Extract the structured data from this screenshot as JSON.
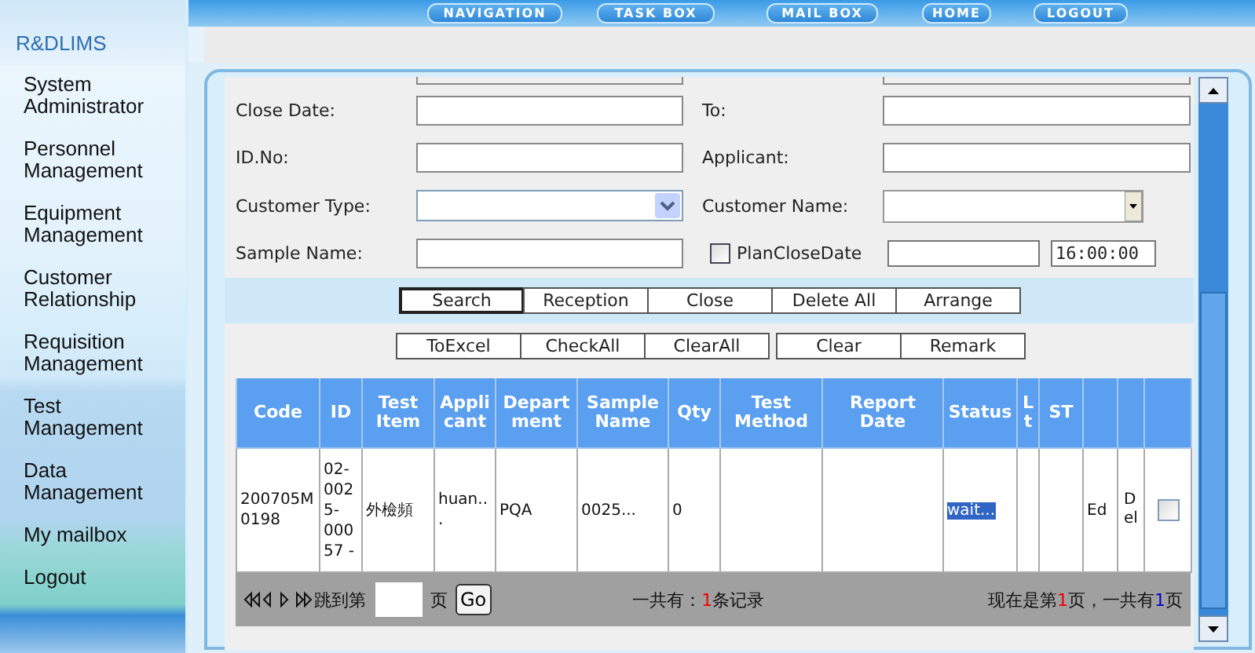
{
  "logo": "R&DLIMS",
  "top_nav": [
    "NAVIGATION",
    "TASK BOX",
    "MAIL BOX",
    "HOME",
    "LOGOUT"
  ],
  "sidebar": {
    "items": [
      {
        "label": "System Administrator"
      },
      {
        "label": "Personnel Management"
      },
      {
        "label": "Equipment Management"
      },
      {
        "label": "Customer Relationship"
      },
      {
        "label": "Requisition Management"
      },
      {
        "label": "Test Management"
      },
      {
        "label": "Data Management"
      },
      {
        "label": "My mailbox"
      },
      {
        "label": "Logout"
      }
    ]
  },
  "form": {
    "rows": [
      {
        "left": {
          "label": "Close Date:",
          "kind": "text"
        },
        "right": {
          "label": "To:",
          "kind": "text"
        }
      },
      {
        "left": {
          "label": "ID.No:",
          "kind": "text"
        },
        "right": {
          "label": "Applicant:",
          "kind": "text"
        }
      },
      {
        "left": {
          "label": "Customer Type:",
          "kind": "select"
        },
        "right": {
          "label": "Customer Name:",
          "kind": "combo"
        }
      },
      {
        "left": {
          "label": "Sample Name:",
          "kind": "text"
        },
        "right": {
          "label": "PlanCloseDate",
          "kind": "checkdate",
          "checked": false,
          "time_value": "16:00:00"
        }
      }
    ]
  },
  "buttons_1": [
    {
      "label": "Search",
      "selected": true
    },
    {
      "label": "Reception",
      "selected": false
    },
    {
      "label": "Close",
      "selected": false
    },
    {
      "label": "Delete All",
      "selected": false
    },
    {
      "label": "Arrange",
      "selected": false
    }
  ],
  "buttons_2": [
    [
      "ToExcel",
      "CheckAll",
      "ClearAll"
    ],
    [
      "Clear",
      "Remark"
    ]
  ],
  "table": {
    "columns": [
      "Code",
      "ID",
      "Test Item",
      "Applicant",
      "Department",
      "Sample Name",
      "Qty",
      "Test Method",
      "Report Date",
      "Status",
      "Lt",
      "ST"
    ],
    "rows": [
      {
        "checked": false,
        "cells": [
          {
            "text": "200705M0198"
          },
          {
            "text": "02-0025-00057 -"
          },
          {
            "text": "外檢頻"
          },
          {
            "text": "huan..."
          },
          {
            "text": "PQA"
          },
          {
            "text": "0025..."
          },
          {
            "text": "0"
          },
          {},
          {},
          {
            "text": "wait...",
            "highlighted": true
          },
          {},
          {},
          {
            "text": "Ed"
          },
          {
            "text": "Del"
          }
        ]
      }
    ]
  },
  "pager": {
    "jump_label": "跳到第",
    "page_unit": "页",
    "go": "Go",
    "total": {
      "before": "一共有：",
      "count": "1",
      "after": "条记录"
    },
    "position": {
      "before": "现在是第",
      "page": "1",
      "middle": "页，一共有",
      "pages": "1",
      "after": "页"
    }
  }
}
